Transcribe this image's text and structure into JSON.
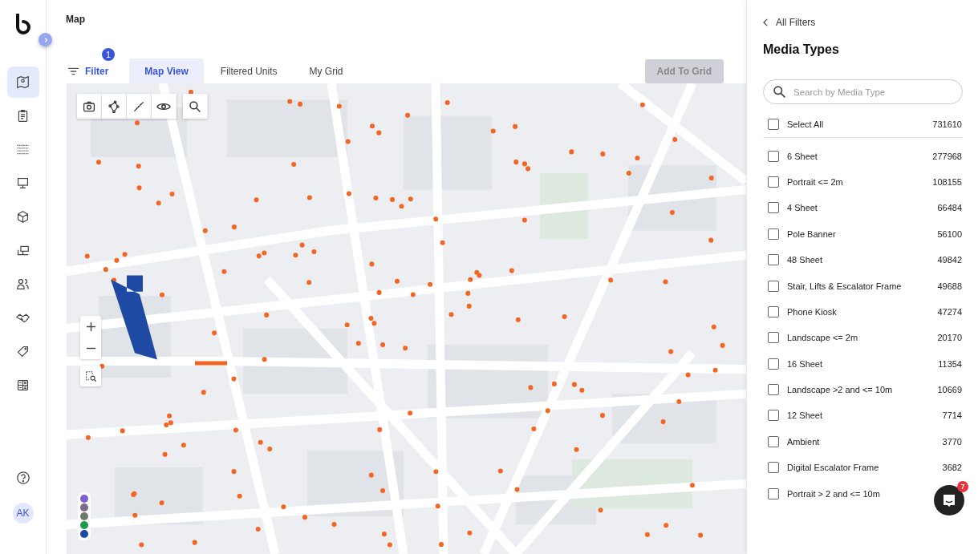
{
  "sidebar": {
    "items": [
      {
        "selected": true
      },
      {
        "selected": false
      },
      {
        "selected": false
      },
      {
        "selected": false
      },
      {
        "selected": false
      },
      {
        "selected": false
      },
      {
        "selected": false
      },
      {
        "selected": false
      },
      {
        "selected": false
      },
      {
        "selected": false
      }
    ],
    "avatar": "AK"
  },
  "page": {
    "title": "Map"
  },
  "toolbar": {
    "filter": {
      "label": "Filter",
      "badge": "1"
    },
    "tabs": [
      {
        "label": "Map View",
        "selected": true
      },
      {
        "label": "Filtered Units",
        "selected": false
      },
      {
        "label": "My Grid",
        "selected": false
      }
    ],
    "add_button": {
      "label": "Add To Grid",
      "disabled": true
    }
  },
  "panel": {
    "back": "All Filters",
    "title": "Media Types",
    "search": {
      "placeholder": "Search by Media Type"
    },
    "select_all": {
      "label": "Select All",
      "count": "731610",
      "checked": false
    },
    "items": [
      {
        "label": "6 Sheet",
        "count": "277968",
        "checked": false
      },
      {
        "label": "Portrait <= 2m",
        "count": "108155",
        "checked": false
      },
      {
        "label": "4 Sheet",
        "count": "66484",
        "checked": false
      },
      {
        "label": "Pole Banner",
        "count": "56100",
        "checked": false
      },
      {
        "label": "48 Sheet",
        "count": "49842",
        "checked": false
      },
      {
        "label": "Stair, Lifts & Escalator Frame",
        "count": "49688",
        "checked": false
      },
      {
        "label": "Phone Kiosk",
        "count": "47274",
        "checked": false
      },
      {
        "label": "Landscape <= 2m",
        "count": "20170",
        "checked": false
      },
      {
        "label": "16 Sheet",
        "count": "11354",
        "checked": false
      },
      {
        "label": "Landscape >2 and <= 10m",
        "count": "10669",
        "checked": false
      },
      {
        "label": "12 Sheet",
        "count": "7714",
        "checked": false
      },
      {
        "label": "Ambient",
        "count": "3770",
        "checked": false
      },
      {
        "label": "Digital Escalator Frame",
        "count": "3682",
        "checked": false
      },
      {
        "label": "Portrait > 2 and <= 10m",
        "checked": false
      }
    ]
  },
  "chat": {
    "badge": "7"
  }
}
